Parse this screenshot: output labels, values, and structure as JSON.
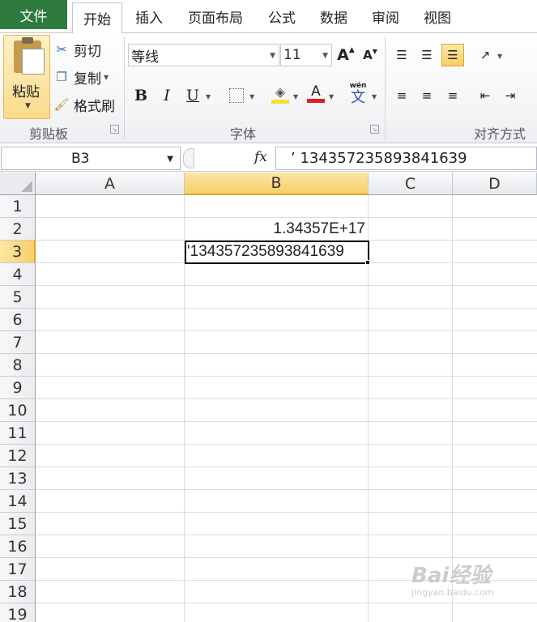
{
  "tabs": {
    "file": "文件",
    "home": "开始",
    "insert": "插入",
    "page_layout": "页面布局",
    "formulas": "公式",
    "data": "数据",
    "review": "审阅",
    "view": "视图"
  },
  "clipboard": {
    "paste": "粘贴",
    "cut": "剪切",
    "copy": "复制",
    "format_painter": "格式刷",
    "group_label": "剪贴板"
  },
  "font": {
    "name": "等线",
    "size": "11",
    "grow_icon": "A",
    "shrink_icon": "A",
    "bold": "B",
    "italic": "I",
    "underline": "U",
    "font_color_letter": "A",
    "wen_top": "wén",
    "wen_char": "文",
    "group_label": "字体"
  },
  "alignment": {
    "group_label": "对齐方式"
  },
  "formula_bar": {
    "name_box": "B3",
    "fx": "fx",
    "content": "’  134357235893841639"
  },
  "grid": {
    "columns": [
      "A",
      "B",
      "C",
      "D"
    ],
    "rows": [
      "1",
      "2",
      "3",
      "4",
      "5",
      "6",
      "7",
      "8",
      "9",
      "10",
      "11",
      "12",
      "13",
      "14",
      "15",
      "16",
      "17",
      "18",
      "19"
    ],
    "selected_column": "B",
    "selected_row": "3",
    "cells": {
      "B2": "1.34357E+17",
      "B3": "'134357235893841639"
    }
  },
  "watermark": {
    "brand": "Bai经验",
    "url": "jingyan.baidu.com"
  },
  "colors": {
    "file_tab": "#2e7a3f",
    "selection_header": "#f8cf6a",
    "highlight_fill": "#f5e12a",
    "font_color_bar": "#e02020"
  }
}
